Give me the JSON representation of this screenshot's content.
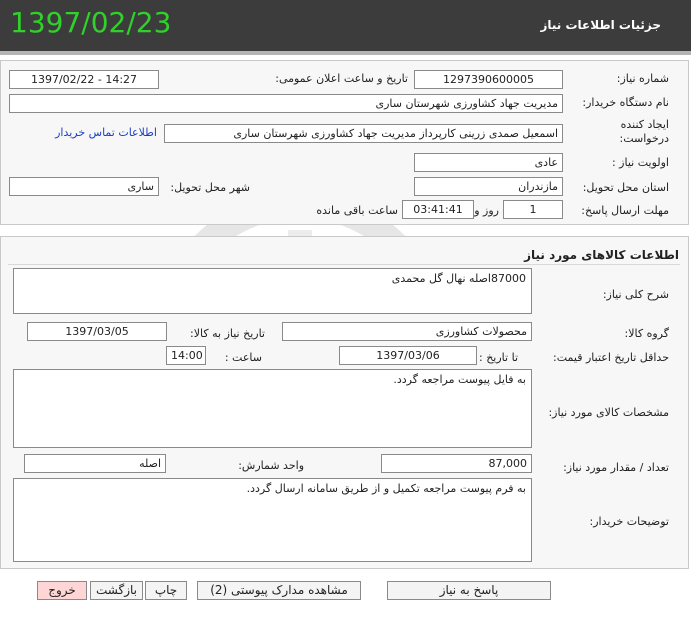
{
  "header": {
    "title": "جزئیات اطلاعات نیاز",
    "date": "1397/02/23"
  },
  "info": {
    "need_number_label": "شماره نیاز:",
    "need_number": "1297390600005",
    "announce_label": "تاریخ و ساعت اعلان عمومی:",
    "announce_value": "1397/02/22 - 14:27",
    "buyer_label": "نام دستگاه خریدار:",
    "buyer_value": "مدیریت جهاد کشاورزی شهرستان ساری",
    "creator_label": "ایجاد کننده درخواست:",
    "creator_value": "اسمعیل  صمدی زرینی  کارپرداز مدیریت جهاد کشاورزی شهرستان ساری",
    "contact_link": "اطلاعات تماس خریدار",
    "priority_label": "اولویت نیاز :",
    "priority_value": "عادی",
    "province_label": "استان محل تحویل:",
    "province_value": "مازندران",
    "city_label": "شهر محل تحویل:",
    "city_value": "ساری",
    "deadline_label": "مهلت ارسال پاسخ:",
    "deadline_days": "1",
    "days_word": "روز و",
    "deadline_time": "03:41:41",
    "remaining_word": "ساعت باقی مانده"
  },
  "goods": {
    "section_title": "اطلاعات کالاهای مورد نیاز",
    "summary_label": "شرح کلی نیاز:",
    "summary_value": "87000اصله نهال گل محمدی",
    "group_label": "گروه کالا:",
    "group_value": "محصولات کشاورزی",
    "need_date_label": "تاریخ نیاز به کالا:",
    "need_date_value": "1397/03/05",
    "validity_label": "حداقل تاریخ اعتبار قیمت:",
    "to_date_label": "تا تاریخ :",
    "to_date_value": "1397/03/06",
    "hour_label": "ساعت :",
    "hour_value": "14:00",
    "specs_label": "مشخصات کالای مورد نیاز:",
    "specs_value": "به فایل پیوست مراجعه گردد.",
    "qty_label": "تعداد / مقدار مورد نیاز:",
    "qty_value": "87,000",
    "unit_label": "واحد شمارش:",
    "unit_value": "اصله",
    "notes_label": "توضیحات خریدار:",
    "notes_value": "به فرم پیوست مراجعه تکمیل و از طریق سامانه ارسال گردد."
  },
  "buttons": {
    "reply": "پاسخ به نیاز",
    "attachments": "مشاهده مدارک پیوستی (2)",
    "print": "چاپ",
    "back": "بازگشت",
    "exit": "خروج"
  },
  "colors": {
    "header_bg": "#3c3c3c",
    "date_green": "#31d12b",
    "exit_red": "#ffd6d6",
    "link_blue": "#1a3fc4"
  }
}
